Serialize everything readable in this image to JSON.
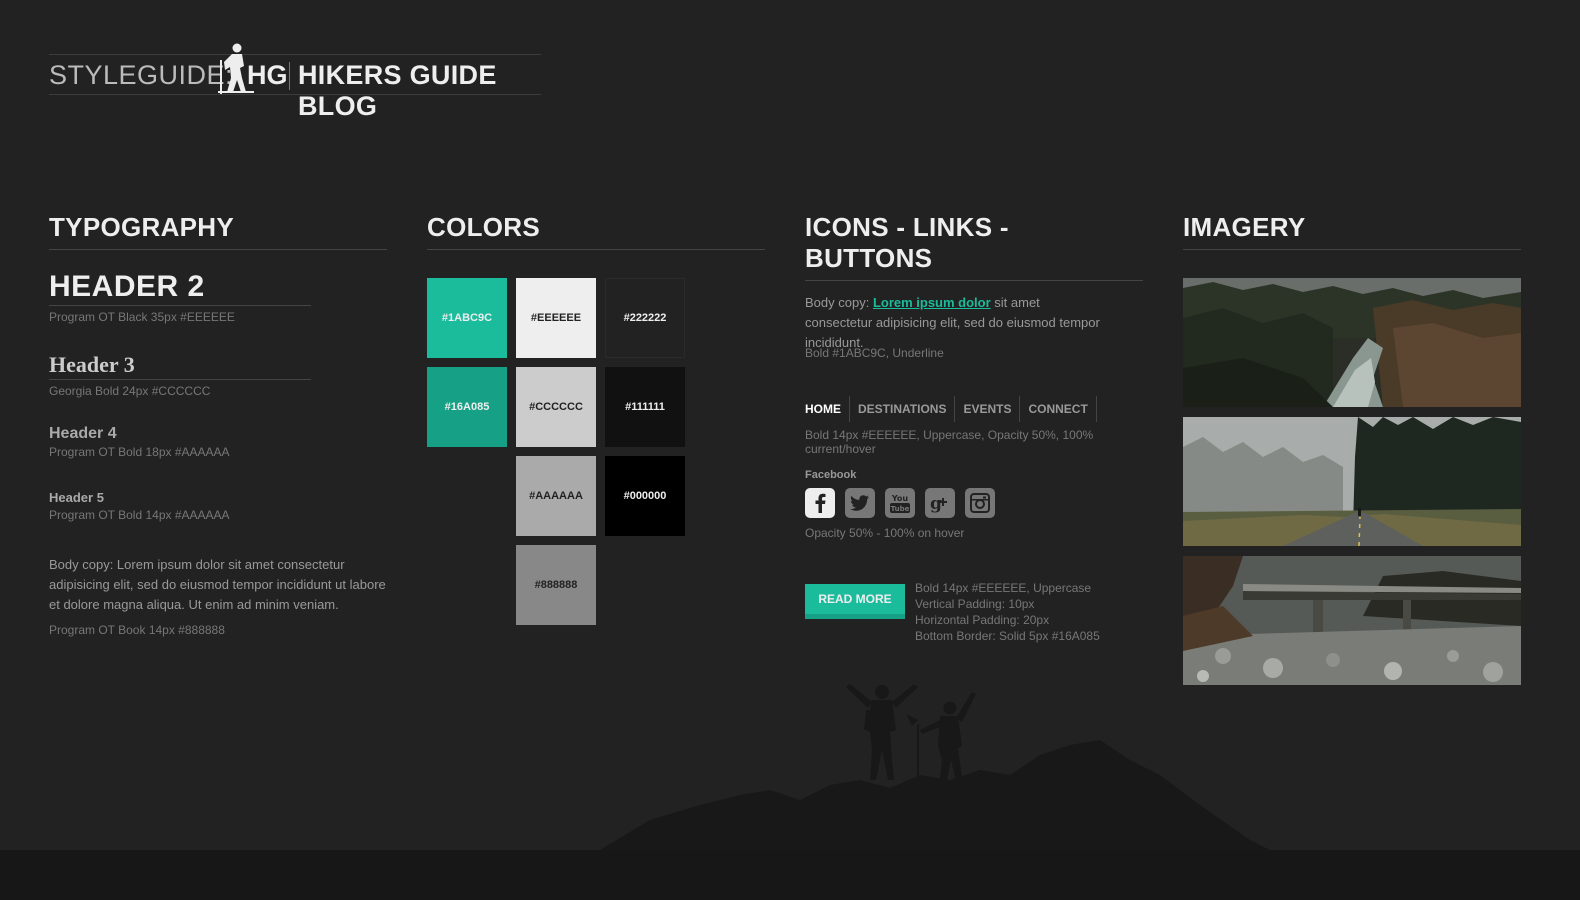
{
  "header": {
    "styleguide": "STYLEGUIDE:",
    "logo_text": "HG",
    "blog_title": "HIKERS GUIDE BLOG"
  },
  "typography": {
    "title": "TYPOGRAPHY",
    "h2": "HEADER 2",
    "h2_spec": "Program OT Black 35px  #EEEEEE",
    "h3": "Header 3",
    "h3_spec": "Georgia Bold 24px  #CCCCCC",
    "h4": "Header 4",
    "h4_spec": "Program OT Bold 18px  #AAAAAA",
    "h5": "Header 5",
    "h5_spec": "Program OT Bold 14px  #AAAAAA",
    "body": "Body copy: Lorem ipsum dolor sit amet consectetur adipisicing elit, sed do eiusmod tempor incididunt ut labore et dolore magna aliqua. Ut enim ad minim veniam.",
    "body_spec": "Program OT Book 14px  #888888"
  },
  "colors": {
    "title": "COLORS",
    "swatches": [
      {
        "label": "#1ABC9C",
        "color": "#1ABC9C",
        "text": "#EEEEEE"
      },
      {
        "label": "#EEEEEE",
        "color": "#EEEEEE",
        "text": "#222222"
      },
      {
        "label": "#222222",
        "color": "#222222",
        "text": "#EEEEEE"
      },
      {
        "label": "#16A085",
        "color": "#16A085",
        "text": "#EEEEEE"
      },
      {
        "label": "#CCCCCC",
        "color": "#CCCCCC",
        "text": "#222222"
      },
      {
        "label": "#111111",
        "color": "#111111",
        "text": "#EEEEEE"
      },
      {
        "label": "#AAAAAA",
        "color": "#AAAAAA",
        "text": "#222222"
      },
      {
        "label": "#000000",
        "color": "#000000",
        "text": "#EEEEEE"
      },
      {
        "label": "#888888",
        "color": "#888888",
        "text": "#222222"
      }
    ]
  },
  "icons": {
    "title": "ICONS - LINKS - BUTTONS",
    "body_prefix": "Body copy: ",
    "link_text": "Lorem ipsum dolor",
    "body_suffix": " sit amet consectetur adipisicing elit, sed do eiusmod tempor incididunt.",
    "link_spec": "Bold #1ABC9C, Underline",
    "nav_items": [
      "HOME",
      "DESTINATIONS",
      "EVENTS",
      "CONNECT"
    ],
    "nav_spec": "Bold 14px #EEEEEE, Uppercase, Opacity 50%, 100% current/hover",
    "social_label": "Facebook",
    "social_icons": [
      "facebook-icon",
      "twitter-icon",
      "youtube-icon",
      "google-plus-icon",
      "instagram-icon"
    ],
    "social_spec": "Opacity 50% - 100% on hover",
    "button_label": "READ MORE",
    "button_spec": [
      "Bold 14px #EEEEEE, Uppercase",
      "Vertical Padding: 10px",
      "Horizontal Padding: 20px",
      "Bottom Border: Solid 5px #16A085"
    ]
  },
  "imagery": {
    "title": "IMAGERY"
  },
  "accent": "#1ABC9C",
  "accent_dark": "#16A085"
}
